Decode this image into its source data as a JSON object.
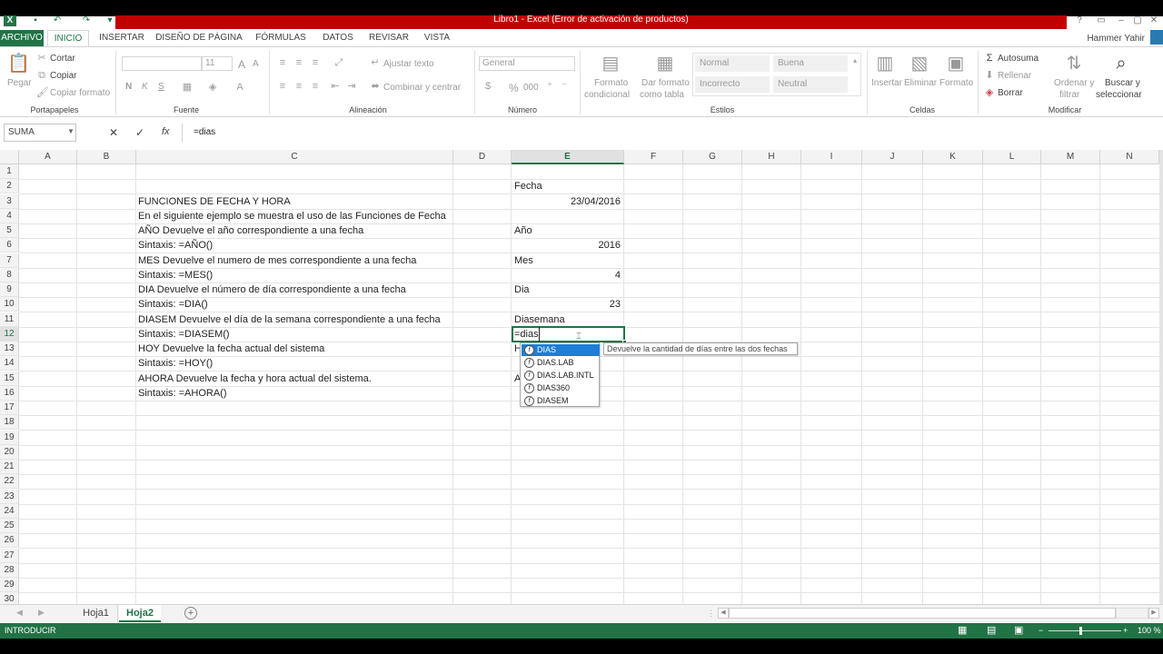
{
  "window": {
    "title": "Libro1 -  Excel (Error de activación de productos)",
    "user": "Hammer Yahir"
  },
  "ribbon_tabs": [
    "ARCHIVO",
    "INICIO",
    "INSERTAR",
    "DISEÑO DE PÁGINA",
    "FÓRMULAS",
    "DATOS",
    "REVISAR",
    "VISTA"
  ],
  "ribbon": {
    "clipboard": {
      "paste": "Pegar",
      "cut": "Cortar",
      "copy": "Copiar",
      "format_painter": "Copiar formato",
      "group": "Portapapeles"
    },
    "font": {
      "font_size": "11",
      "bold": "N",
      "italic": "K",
      "underline": "S",
      "grow": "A",
      "shrink": "A",
      "group": "Fuente"
    },
    "alignment": {
      "wrap": "Ajustar texto",
      "merge": "Combinar y centrar",
      "group": "Alineación"
    },
    "number": {
      "format": "General",
      "percent": "%",
      "thousands": "000",
      "group": "Número"
    },
    "styles": {
      "conditional_line1": "Formato",
      "conditional_line2": "condicional",
      "table_line1": "Dar formato",
      "table_line2": "como tabla",
      "normal": "Normal",
      "good": "Buena",
      "bad": "Incorrecto",
      "neutral": "Neutral",
      "group": "Estilos"
    },
    "cells": {
      "insert": "Insertar",
      "delete": "Eliminar",
      "format": "Formato",
      "group": "Celdas"
    },
    "editing": {
      "autosum": "Autosuma",
      "fill": "Rellenar",
      "clear": "Borrar",
      "sort_line1": "Ordenar y",
      "sort_line2": "filtrar",
      "find_line1": "Buscar y",
      "find_line2": "seleccionar",
      "group": "Modificar"
    }
  },
  "formula_bar": {
    "name_box": "SUMA",
    "cancel": "✕",
    "enter": "✓",
    "fx": "fx",
    "formula": "=dias"
  },
  "columns": [
    "A",
    "B",
    "C",
    "D",
    "E",
    "F",
    "G",
    "H",
    "I",
    "J",
    "K",
    "L",
    "M",
    "N"
  ],
  "rows": [
    "1",
    "2",
    "3",
    "4",
    "5",
    "6",
    "7",
    "8",
    "9",
    "10",
    "11",
    "12",
    "13",
    "14",
    "15",
    "16",
    "17",
    "18",
    "19",
    "20",
    "21",
    "22",
    "23",
    "24",
    "25",
    "26",
    "27",
    "28",
    "29",
    "30"
  ],
  "cells": {
    "C3": "FUNCIONES DE FECHA Y HORA",
    "C4": "En el siguiente ejemplo se muestra el uso de las Funciones de Fecha",
    "C5": "AÑO Devuelve el año correspondiente a una fecha",
    "C6": "Sintaxis: =AÑO()",
    "C7": "MES Devuelve el numero de mes correspondiente  a una fecha",
    "C8": "Sintaxis: =MES()",
    "C9": "DIA Devuelve el número de día correspondiente a una fecha",
    "C10": "Sintaxis: =DIA()",
    "C11": "DIASEM Devuelve el día de la semana correspondiente a una fecha",
    "C12": "Sintaxis: =DIASEM()",
    "C13": "HOY Devuelve la fecha actual del sistema",
    "C14": "Sintaxis: =HOY()",
    "C15": "AHORA Devuelve la fecha y hora actual del sistema.",
    "C16": "Sintaxis: =AHORA()",
    "E2": "Fecha",
    "E3": "23/04/2016",
    "E5": "Año",
    "E6": "2016",
    "E7": "Mes",
    "E8": "4",
    "E9": "Dia",
    "E10": "23",
    "E11": "Diasemana",
    "E12": "=dias",
    "E13": "H",
    "E15": "A"
  },
  "autocomplete": {
    "items": [
      "DIAS",
      "DIAS.LAB",
      "DIAS.LAB.INTL",
      "DIAS360",
      "DIASEM"
    ],
    "tooltip": "Devuelve la cantidad de días entre las dos fechas"
  },
  "sheets": [
    "Hoja1",
    "Hoja2"
  ],
  "active_sheet": "Hoja2",
  "status": {
    "mode": "INTRODUCIR",
    "zoom": "100 %"
  },
  "colors": {
    "excel_green": "#217346",
    "activation_red": "#c00000",
    "selection_blue": "#1e7dd4"
  }
}
